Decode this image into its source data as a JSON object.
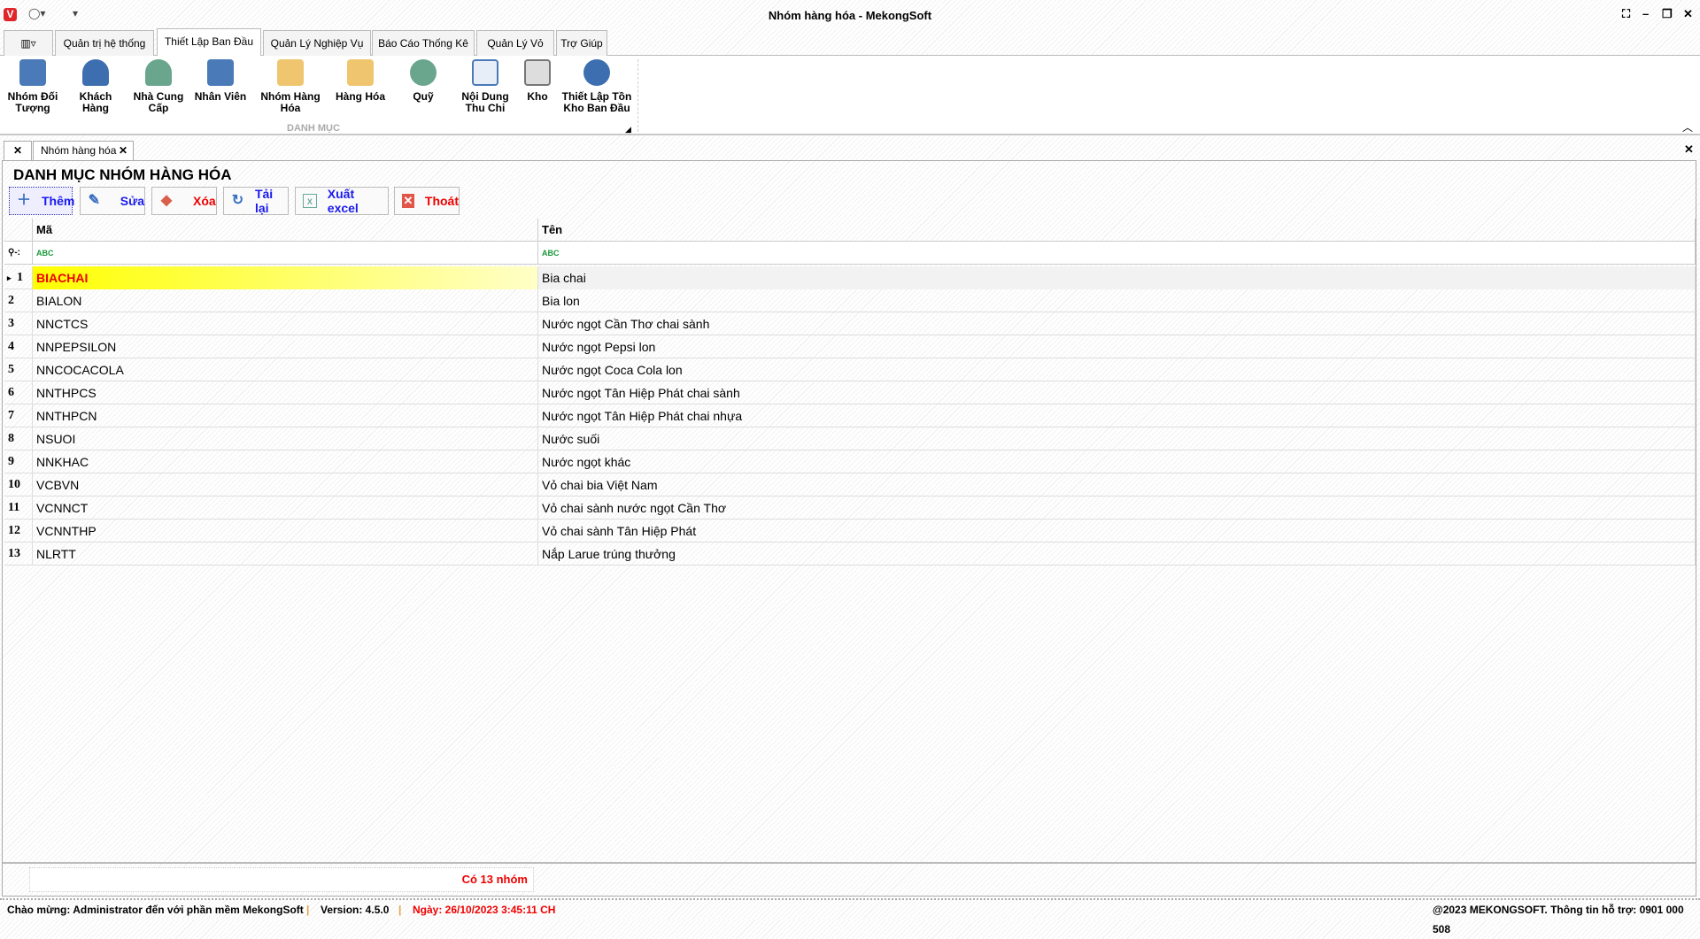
{
  "window": {
    "title": "Nhóm hàng hóa - MekongSoft",
    "logo": "V"
  },
  "ribbon_tabs": [
    "Quản trị hệ thống",
    "Thiết Lập Ban Đầu",
    "Quản Lý Nghiệp Vụ",
    "Báo Cáo Thống Kê",
    "Quản Lý Vỏ",
    "Trợ Giúp"
  ],
  "ribbon_buttons": [
    "Nhóm Đối Tượng",
    "Khách Hàng",
    "Nhà Cung Cấp",
    "Nhân Viên",
    "Nhóm Hàng Hóa",
    "Hàng Hóa",
    "Quỹ",
    "Nội Dung Thu Chi",
    "Kho",
    "Thiết Lập Tồn Kho Ban Đầu"
  ],
  "ribbon_group": "DANH MỤC",
  "doc_tab": "Nhóm hàng hóa",
  "page_title": "DANH MỤC NHÓM HÀNG HÓA",
  "toolbar": {
    "add": "Thêm",
    "edit": "Sửa",
    "delete": "Xóa",
    "reload": "Tải lại",
    "export": "Xuất excel",
    "exit": "Thoát"
  },
  "columns": {
    "code": "Mã",
    "name": "Tên"
  },
  "rows": [
    {
      "n": "1",
      "code": "BIACHAI",
      "name": "Bia chai"
    },
    {
      "n": "2",
      "code": "BIALON",
      "name": "Bia lon"
    },
    {
      "n": "3",
      "code": "NNCTCS",
      "name": "Nước ngọt Cần Thơ chai sành"
    },
    {
      "n": "4",
      "code": "NNPEPSILON",
      "name": "Nước ngọt Pepsi lon"
    },
    {
      "n": "5",
      "code": "NNCOCACOLA",
      "name": "Nước ngọt Coca Cola lon"
    },
    {
      "n": "6",
      "code": "NNTHPCS",
      "name": "Nước ngọt Tân Hiệp Phát chai sành"
    },
    {
      "n": "7",
      "code": "NNTHPCN",
      "name": "Nước ngọt Tân Hiệp Phát chai nhựa"
    },
    {
      "n": "8",
      "code": "NSUOI",
      "name": "Nước suối"
    },
    {
      "n": "9",
      "code": "NNKHAC",
      "name": "Nước ngọt khác"
    },
    {
      "n": "10",
      "code": "VCBVN",
      "name": "Vỏ chai bia Việt Nam"
    },
    {
      "n": "11",
      "code": "VCNNCT",
      "name": "Vỏ chai sành nước ngọt Cần Thơ"
    },
    {
      "n": "12",
      "code": "VCNNTHP",
      "name": "Vỏ chai sành Tân Hiệp Phát"
    },
    {
      "n": "13",
      "code": "NLRTT",
      "name": "Nắp Larue trúng thưởng"
    }
  ],
  "footer": {
    "count": "Có 13 nhóm"
  },
  "status": {
    "welcome": "Chào mừng: Administrator đến với phần mềm MekongSoft",
    "version": "Version: 4.5.0",
    "date": "Ngày: 26/10/2023 3:45:11 CH",
    "copyright": "@2023 MEKONGSOFT. Thông tin hỗ trợ: 0901 000 508"
  }
}
